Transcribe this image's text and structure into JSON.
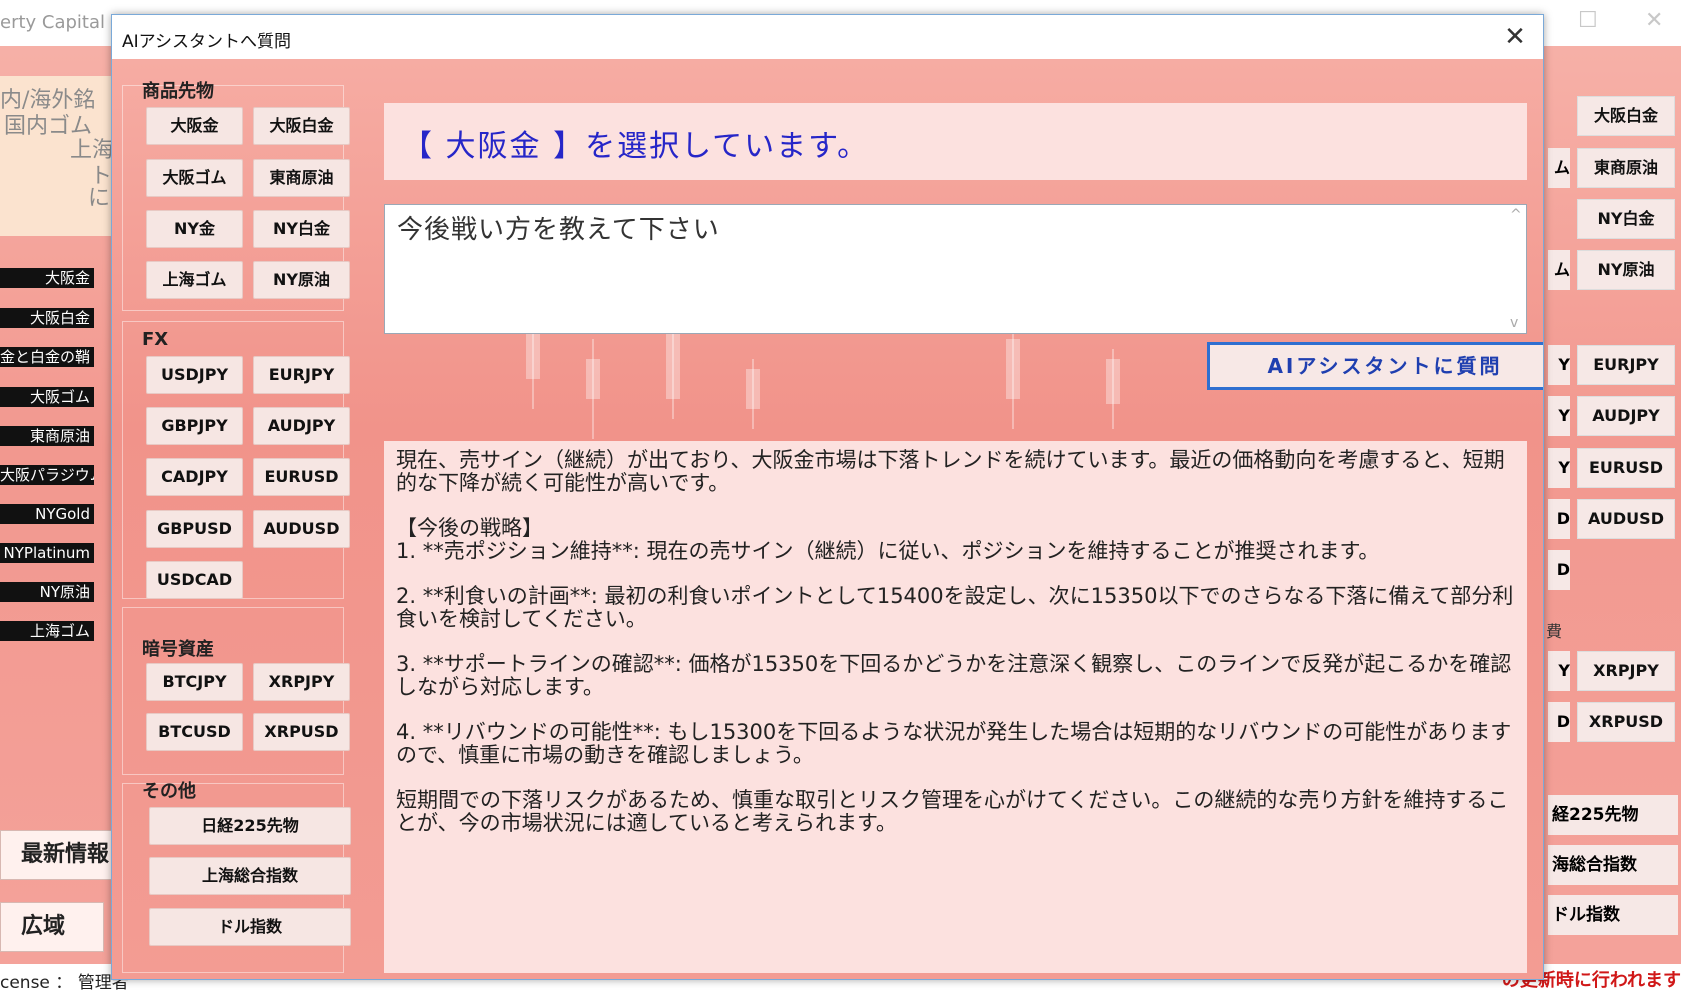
{
  "background": {
    "window_title": "erty Capital W",
    "info_lines": [
      "内/海外銘",
      "国内ゴム",
      "上海",
      "ト",
      "に"
    ],
    "left_list": [
      "大阪金",
      "大阪白金",
      "金と白金の鞘",
      "大阪ゴム",
      "東商原油",
      "大阪パラジウム",
      "NYGold",
      "NYPlatinum",
      "NY原油",
      "上海ゴム"
    ],
    "big_buttons": [
      "最新情報",
      "広域"
    ],
    "right_buttons": [
      "大阪白金",
      "東商原油",
      "NY白金",
      "NY原油",
      "EURJPY",
      "AUDJPY",
      "EURUSD",
      "AUDUSD",
      "XRPJPY",
      "XRPUSD"
    ],
    "right_partial": [
      "ム",
      "ム",
      "Y",
      "Y",
      "Y",
      "D",
      "D",
      "Y",
      "D"
    ],
    "right_wide": [
      "経225先物",
      "海総合指数",
      "ドル指数"
    ],
    "right_label_mid": "費",
    "bottom_left": "cense ： 管理者",
    "bottom_right": "の更新時に行われます"
  },
  "dialog": {
    "title": "AIアシスタントへ質問",
    "close_label": "✕",
    "groups": {
      "commodities": {
        "label": "商品先物",
        "buttons": [
          "大阪金",
          "大阪白金",
          "大阪ゴム",
          "東商原油",
          "NY金",
          "NY白金",
          "上海ゴム",
          "NY原油"
        ]
      },
      "fx": {
        "label": "FX",
        "buttons": [
          "USDJPY",
          "EURJPY",
          "GBPJPY",
          "AUDJPY",
          "CADJPY",
          "EURUSD",
          "GBPUSD",
          "AUDUSD",
          "USDCAD"
        ]
      },
      "crypto": {
        "label": "暗号資産",
        "buttons": [
          "BTCJPY",
          "XRPJPY",
          "BTCUSD",
          "XRPUSD"
        ]
      },
      "other": {
        "label": "その他",
        "buttons": [
          "日経225先物",
          "上海総合指数",
          "ドル指数"
        ]
      }
    },
    "selected_text": "【 大阪金 】を選択しています。",
    "question": {
      "value": "今後戦い方を教えて下さい",
      "scroll_up": "^",
      "scroll_down": "v"
    },
    "ask_button": "AIアシスタントに質問",
    "answer": [
      "現在、売サイン（継続）が出ており、大阪金市場は下落トレンドを続けています。最近の価格動向を考慮すると、短期的な下降が続く可能性が高いです。",
      "【今後の戦略】\n1. **売ポジション維持**: 現在の売サイン（継続）に従い、ポジションを維持することが推奨されます。",
      "2. **利食いの計画**: 最初の利食いポイントとして15400を設定し、次に15350以下でのさらなる下落に備えて部分利食いを検討してください。",
      "3. **サポートラインの確認**: 価格が15350を下回るかどうかを注意深く観察し、このラインで反発が起こるかを確認しながら対応します。",
      "4. **リバウンドの可能性**: もし15300を下回るような状況が発生した場合は短期的なリバウンドの可能性がありますので、慎重に市場の動きを確認しましょう。",
      "短期間での下落リスクがあるため、慎重な取引とリスク管理を心がけてください。この継続的な売り方針を維持することが、今の市場状況には適していると考えられます。"
    ]
  }
}
